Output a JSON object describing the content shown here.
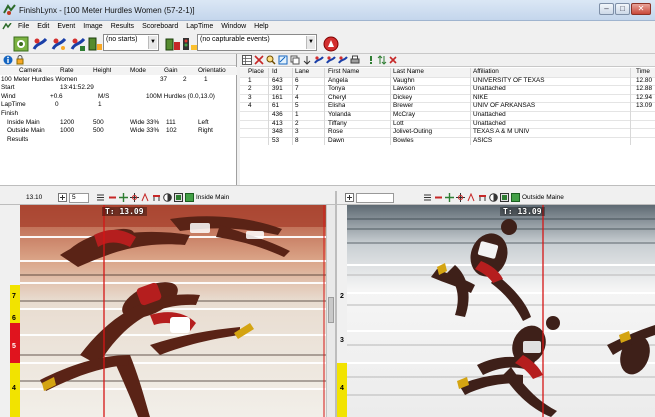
{
  "window": {
    "title": "FinishLynx - [100 Meter Hurdles Women (57-2-1)]",
    "buttons": [
      "–",
      "□",
      "✕"
    ]
  },
  "menu": [
    "File",
    "Edit",
    "Event",
    "Image",
    "Results",
    "Scoreboard",
    "LapTime",
    "Window",
    "Help"
  ],
  "toolbar": {
    "start_select": "(no starts)",
    "capture_select": "(no capturable events)"
  },
  "event_info": {
    "headers": [
      "Camera",
      "Rate",
      "Height",
      "Mode",
      "Gain",
      "Orientatio"
    ],
    "event_row": [
      "100 Meter Hurdles Women",
      "",
      "",
      "",
      "37",
      "2",
      "1"
    ],
    "start_label": "Start",
    "start_value": "13:41:52.29",
    "wind_label": "Wind",
    "wind_value": "+0.6",
    "wind_unit": "M/S",
    "wind_mode": "100M Hurdles (0.0,13.0)",
    "laptime_label": "LapTime",
    "laptime_value": "0",
    "laptime_value2": "1",
    "finish_label": "Finish",
    "cameras": [
      {
        "name": "Inside Main",
        "rate": "1200",
        "height": "500",
        "mode": "Wide 33%",
        "gain": "111",
        "orientation": "Left"
      },
      {
        "name": "Outside Main",
        "rate": "1000",
        "height": "500",
        "mode": "Wide 33%",
        "gain": "102",
        "orientation": "Right"
      }
    ],
    "results_label": "Results"
  },
  "results": {
    "headers": [
      "Place",
      "Id",
      "Lane",
      "First Name",
      "Last Name",
      "Affiliation",
      "Time"
    ],
    "rows": [
      {
        "place": "1",
        "id": "643",
        "lane": "6",
        "first": "Angela",
        "last": "Vaughn",
        "affiliation": "UNIVERSITY OF TEXAS",
        "time": "12.80"
      },
      {
        "place": "2",
        "id": "391",
        "lane": "7",
        "first": "Tonya",
        "last": "Lawson",
        "affiliation": "Unattached",
        "time": "12.88"
      },
      {
        "place": "3",
        "id": "161",
        "lane": "4",
        "first": "Cheryl",
        "last": "Dickey",
        "affiliation": "NIKE",
        "time": "12.94"
      },
      {
        "place": "4",
        "id": "61",
        "lane": "5",
        "first": "Elisha",
        "last": "Brewer",
        "affiliation": "UNIV OF ARKANSAS",
        "time": "13.09"
      },
      {
        "place": "",
        "id": "436",
        "lane": "1",
        "first": "Yolanda",
        "last": "McCray",
        "affiliation": "Unattached",
        "time": ""
      },
      {
        "place": "",
        "id": "413",
        "lane": "2",
        "first": "Tiffany",
        "last": "Lott",
        "affiliation": "Unattached",
        "time": ""
      },
      {
        "place": "",
        "id": "348",
        "lane": "3",
        "first": "Rose",
        "last": "Jolivet-Outing",
        "affiliation": "TEXAS A & M UNIV",
        "time": ""
      },
      {
        "place": "",
        "id": "53",
        "lane": "8",
        "first": "Dawn",
        "last": "Bowles",
        "affiliation": "ASICS",
        "time": ""
      }
    ]
  },
  "left_pane": {
    "time_field": "13.10",
    "zoom_value": "5",
    "camera_label": "Inside Main",
    "timestamp": "T: 13.09",
    "lane_labels": [
      "7",
      "6",
      "5",
      "4"
    ]
  },
  "right_pane": {
    "camera_label": "Outside Maine",
    "timestamp": "T: 13.09",
    "lane_labels": [
      "2",
      "3",
      "4"
    ]
  },
  "colors": {
    "lane_yellow": "#f2e300",
    "lane_red": "#e0141e",
    "track_red": "#b23a2a",
    "cursor_line": "#d51616"
  }
}
